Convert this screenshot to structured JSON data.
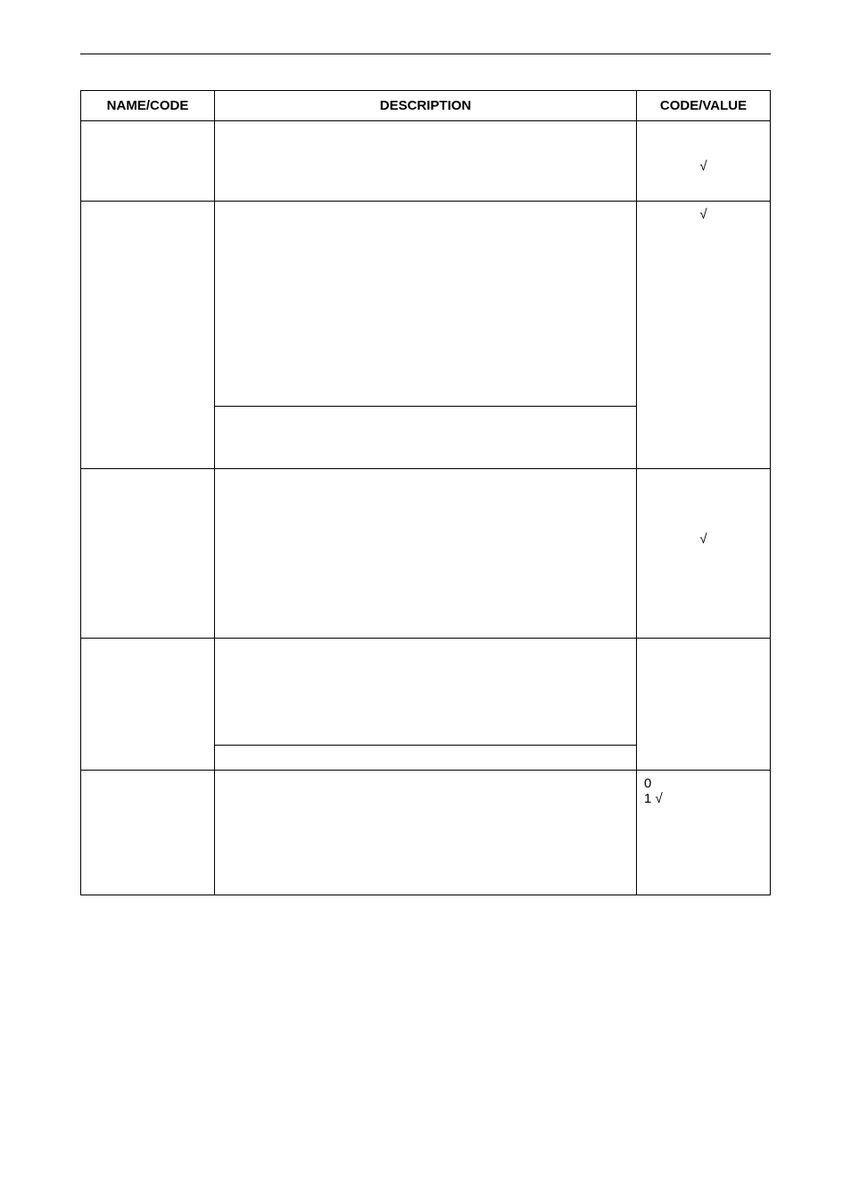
{
  "headers": {
    "name": "NAME/CODE",
    "description": "DESCRIPTION",
    "code_value": "CODE/VALUE"
  },
  "rows": [
    {
      "name": "",
      "desc1": "",
      "desc2": null,
      "cv": "√",
      "cv_class": "cv-center cv-pad-top",
      "h1": "tall-1",
      "h2": null,
      "rowspan_name": 1,
      "rowspan_cv": 1
    },
    {
      "name": "",
      "desc1": "",
      "desc2": "",
      "cv": "√",
      "cv_class": "cv-center cv-pad-top2",
      "h1": "tall-2",
      "h2": "tall-2b",
      "rowspan_name": 2,
      "rowspan_cv": 2
    },
    {
      "name": "",
      "desc1": "",
      "desc2": null,
      "cv": "√",
      "cv_class": "cv-center cv-pad-top3",
      "h1": "tall-3",
      "h2": null,
      "rowspan_name": 1,
      "rowspan_cv": 1
    },
    {
      "name": "",
      "desc1": "",
      "desc2": "",
      "cv": "",
      "cv_class": "cv-left",
      "h1": "tall-4",
      "h2": "tall-4b",
      "rowspan_name": 2,
      "rowspan_cv": 2
    },
    {
      "name": "",
      "desc1": "",
      "desc2": null,
      "cv": "0\n1 √",
      "cv_class": "cv-left",
      "h1": "tall-5",
      "h2": null,
      "rowspan_name": 1,
      "rowspan_cv": 1
    }
  ]
}
